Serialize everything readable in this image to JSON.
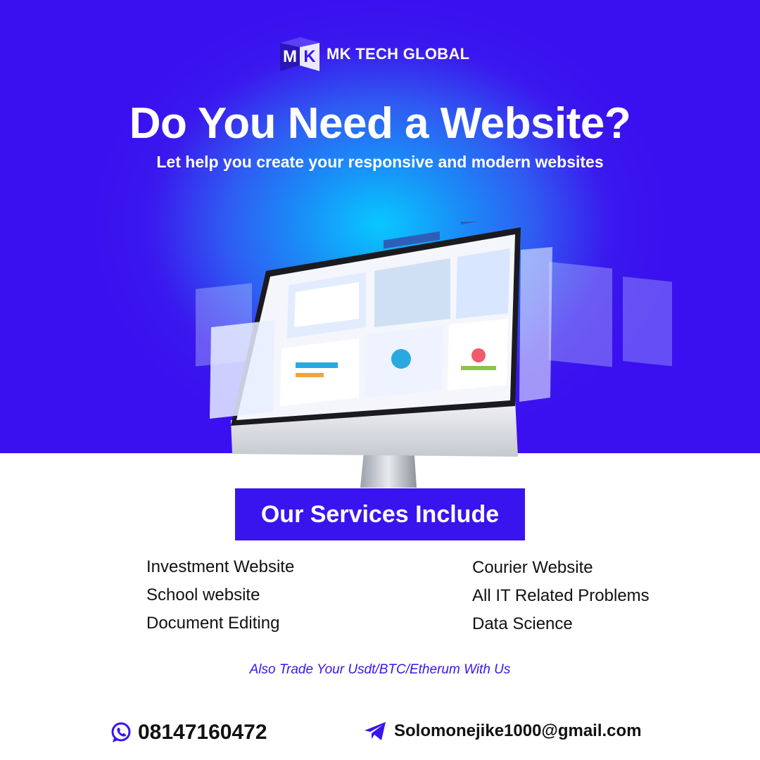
{
  "brand": {
    "monogram_left": "M",
    "monogram_right": "K",
    "name": "MK TECH GLOBAL"
  },
  "hero": {
    "headline": "Do You Need a Website?",
    "subline": "Let help you create your responsive and modern websites"
  },
  "colors": {
    "accent": "#3a14ee",
    "hero_glow": "#08c8ff",
    "text": "#111111",
    "white": "#ffffff"
  },
  "services": {
    "title": "Our Services Include",
    "left": [
      "Investment Website",
      "School website",
      "Document Editing"
    ],
    "right": [
      "Courier Website",
      "All IT Related Problems",
      "Data Science"
    ]
  },
  "trade_note": "Also Trade Your Usdt/BTC/Etherum With Us",
  "contact": {
    "phone": "08147160472",
    "phone_icon": "whatsapp-icon",
    "email": "Solomonejike1000@gmail.com",
    "email_icon": "telegram-icon"
  }
}
